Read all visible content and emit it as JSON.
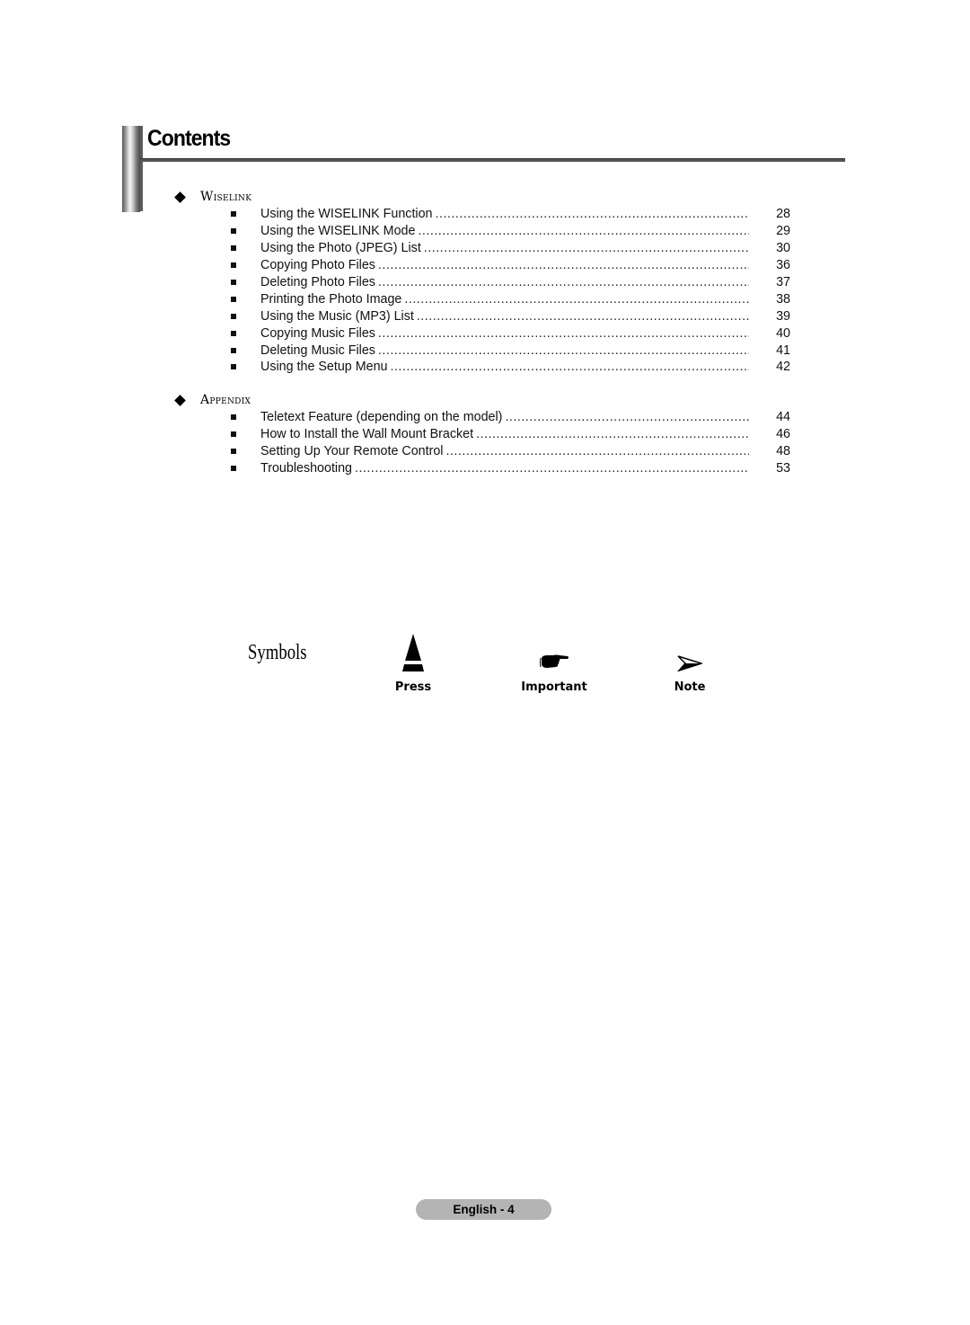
{
  "page": {
    "title": "Contents"
  },
  "sections": [
    {
      "title": "Wiselink",
      "items": [
        {
          "text": "Using the WISELINK Function",
          "page": "28"
        },
        {
          "text": "Using the WISELINK Mode",
          "page": "29"
        },
        {
          "text": "Using the Photo (JPEG) List",
          "page": "30"
        },
        {
          "text": "Copying Photo Files",
          "page": "36"
        },
        {
          "text": "Deleting Photo Files",
          "page": "37"
        },
        {
          "text": "Printing the Photo Image",
          "page": "38"
        },
        {
          "text": "Using the Music (MP3) List",
          "page": "39"
        },
        {
          "text": "Copying Music Files",
          "page": "40"
        },
        {
          "text": "Deleting Music Files",
          "page": "41"
        },
        {
          "text": "Using the Setup Menu",
          "page": "42"
        }
      ]
    },
    {
      "title": "Appendix",
      "items": [
        {
          "text": "Teletext Feature (depending on the model)",
          "page": "44"
        },
        {
          "text": "How to Install the Wall Mount Bracket",
          "page": "46"
        },
        {
          "text": "Setting Up Your Remote Control",
          "page": "48"
        },
        {
          "text": "Troubleshooting",
          "page": "53"
        }
      ]
    }
  ],
  "symbols": {
    "label": "Symbols",
    "items": [
      {
        "icon": "press-icon",
        "caption": "Press"
      },
      {
        "icon": "pointing-hand-icon",
        "caption": "Important"
      },
      {
        "icon": "arrowhead-icon",
        "caption": "Note"
      }
    ]
  },
  "footer": {
    "page_label": "English - 4"
  }
}
